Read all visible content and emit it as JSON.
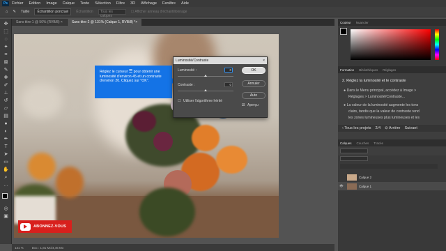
{
  "app": {
    "logo": "Ps"
  },
  "menu": [
    "Fichier",
    "Edition",
    "Image",
    "Calque",
    "Texte",
    "Sélection",
    "Filtre",
    "3D",
    "Affichage",
    "Fenêtre",
    "Aide"
  ],
  "options": {
    "home_icon": "home-icon",
    "tool_icon": "eyedropper-icon",
    "size_label": "Taille",
    "sample_select": "Échantillon ponctuel",
    "sample_from": "Échantillon",
    "all_layers": "Tous les calques",
    "show_ring": "Afficher anneau d'échantillonnage"
  },
  "tabs": [
    {
      "label": "Sans titre-1 @ 50% (RVB/8) ×",
      "active": false
    },
    {
      "label": "Sans titre-2 @ 131% (Calque 1, RVB/8) *×",
      "active": true
    }
  ],
  "status": {
    "zoom": "131 %",
    "doc": "Doc : 1,81 Mo/4,45 Mo"
  },
  "tooltip": {
    "text_before": "Réglez le curseur",
    "text_after": "pour obtenir une luminosité d'environ 45 et un contraste d'environ 20. Cliquez sur \"OK\".",
    "icon": "sliders-icon"
  },
  "dialog": {
    "title": "Luminosité/Contraste",
    "brightness_label": "Luminosité :",
    "brightness_value": "0",
    "contrast_label": "Contraste :",
    "contrast_value": "0",
    "legacy_label": "Utiliser l'algorithme hérité",
    "preview_label": "Aperçu",
    "ok": "OK",
    "cancel": "Annuler",
    "auto": "Auto",
    "brightness_level": 0.5,
    "contrast_level": 0.5
  },
  "subscribe": {
    "label": "ABONNEZ-VOUS"
  },
  "panels": {
    "color_tabs": [
      "Couleur",
      "Nuancier"
    ],
    "learn_tabs": [
      "Formation",
      "Bibliothèques",
      "Réglages"
    ],
    "learn": {
      "step": "2.  Réglez la luminosité et le contraste",
      "line1": "Dans le Menu principal, accédez à Image >",
      "line2": "Réglages > Luminosité/Contraste...",
      "line3": "La valeur de la luminosité augmente les tons",
      "line4": "clairs, tandis que la valeur de contraste rend",
      "line5": "les zones lumineuses plus lumineuses et les",
      "all_projects": "Tous les projets",
      "progress": "2/4",
      "back": "Arrière",
      "next": "Suivant"
    },
    "layers_tabs": [
      "Calques",
      "Couches",
      "Tracés"
    ],
    "layers": [
      {
        "name": "Calque 2",
        "visible": false
      },
      {
        "name": "Calque 1",
        "visible": true
      }
    ]
  },
  "colors": {
    "accent": "#1473e6",
    "youtube_red": "#d8201d"
  }
}
